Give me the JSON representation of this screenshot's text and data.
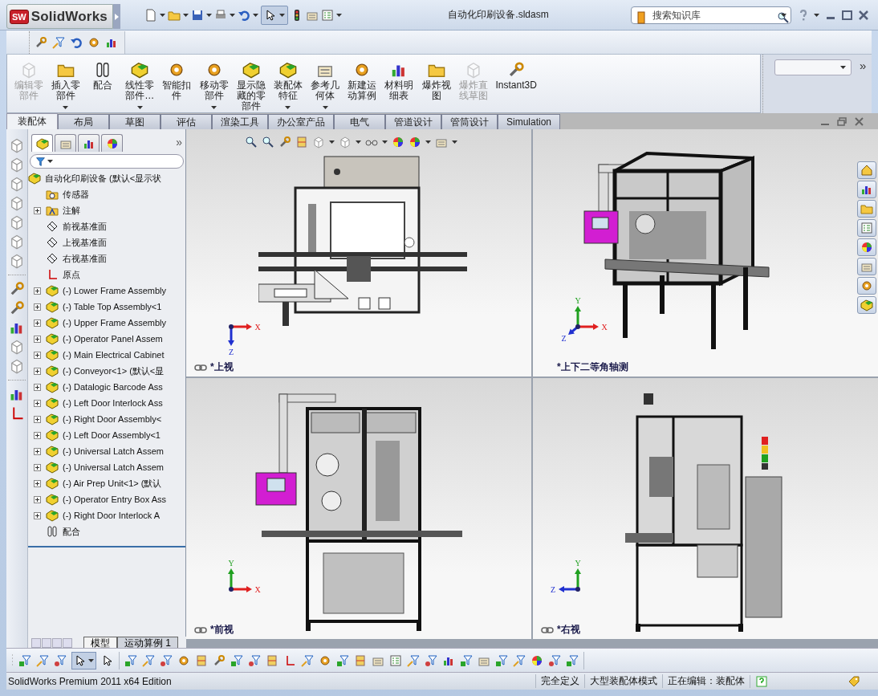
{
  "title_bar": {
    "logo_badge": "SW",
    "app_name": "SolidWorks",
    "document_title": "自动化印刷设备.sldasm",
    "search": {
      "placeholder": "搜索知识库"
    }
  },
  "command_manager": {
    "buttons": [
      {
        "label": "编辑零部件",
        "disabled": true,
        "dropdown": false
      },
      {
        "label": "插入零部件",
        "disabled": false,
        "dropdown": true
      },
      {
        "label": "配合",
        "disabled": false,
        "dropdown": false
      },
      {
        "label": "线性零部件…",
        "disabled": false,
        "dropdown": true
      },
      {
        "label": "智能扣件",
        "disabled": false,
        "dropdown": false
      },
      {
        "label": "移动零部件",
        "disabled": false,
        "dropdown": true
      },
      {
        "label": "显示隐藏的零部件",
        "disabled": false,
        "dropdown": false
      },
      {
        "label": "装配体特征",
        "disabled": false,
        "dropdown": true
      },
      {
        "label": "参考几何体",
        "disabled": false,
        "dropdown": true
      },
      {
        "label": "新建运动算例",
        "disabled": false,
        "dropdown": false
      },
      {
        "label": "材料明细表",
        "disabled": false,
        "dropdown": false
      },
      {
        "label": "爆炸视图",
        "disabled": false,
        "dropdown": false
      },
      {
        "label": "爆炸直线草图",
        "disabled": true,
        "dropdown": false
      },
      {
        "label": "Instant3D",
        "disabled": false,
        "dropdown": false
      }
    ],
    "more": "»"
  },
  "tabs": [
    {
      "label": "装配体",
      "selected": true
    },
    {
      "label": "布局",
      "selected": false
    },
    {
      "label": "草图",
      "selected": false
    },
    {
      "label": "评估",
      "selected": false
    },
    {
      "label": "渲染工具",
      "selected": false
    },
    {
      "label": "办公室产品",
      "selected": false
    },
    {
      "label": "电气",
      "selected": false
    },
    {
      "label": "管道设计",
      "selected": false
    },
    {
      "label": "管筒设计",
      "selected": false
    },
    {
      "label": "Simulation",
      "selected": false
    }
  ],
  "feature_manager": {
    "panel_tabs": [
      {
        "selected": true
      },
      {
        "selected": false
      },
      {
        "selected": false
      },
      {
        "selected": false
      }
    ],
    "more": "»",
    "tree": {
      "label": "自动化印刷设备  (默认<显示状",
      "kind": "assembly",
      "children": [
        {
          "label": "传感器",
          "kind": "sensor",
          "expandable": false
        },
        {
          "label": "注解",
          "kind": "annotation",
          "expandable": true
        },
        {
          "label": "前视基准面",
          "kind": "plane",
          "expandable": false
        },
        {
          "label": "上视基准面",
          "kind": "plane",
          "expandable": false
        },
        {
          "label": "右视基准面",
          "kind": "plane",
          "expandable": false
        },
        {
          "label": "原点",
          "kind": "origin",
          "expandable": false
        },
        {
          "label": "(-) Lower Frame Assembly",
          "kind": "assembly",
          "expandable": true
        },
        {
          "label": "(-) Table Top Assembly<1",
          "kind": "assembly",
          "expandable": true
        },
        {
          "label": "(-) Upper Frame Assembly",
          "kind": "assembly",
          "expandable": true
        },
        {
          "label": "(-) Operator Panel Assem",
          "kind": "assembly",
          "expandable": true
        },
        {
          "label": "(-) Main Electrical Cabinet",
          "kind": "assembly",
          "expandable": true
        },
        {
          "label": "(-) Conveyor<1> (默认<显",
          "kind": "assembly",
          "expandable": true
        },
        {
          "label": "(-) Datalogic Barcode Ass",
          "kind": "assembly",
          "expandable": true
        },
        {
          "label": "(-) Left Door Interlock Ass",
          "kind": "assembly",
          "expandable": true
        },
        {
          "label": "(-) Right Door Assembly<",
          "kind": "assembly",
          "expandable": true
        },
        {
          "label": "(-) Left Door Assembly<1",
          "kind": "assembly",
          "expandable": true
        },
        {
          "label": "(-) Universal Latch Assem",
          "kind": "assembly",
          "expandable": true
        },
        {
          "label": "(-) Universal Latch Assem",
          "kind": "assembly",
          "expandable": true
        },
        {
          "label": "(-) Air Prep Unit<1> (默认",
          "kind": "assembly",
          "expandable": true
        },
        {
          "label": "(-) Operator Entry Box Ass",
          "kind": "assembly",
          "expandable": true
        },
        {
          "label": "(-) Right Door Interlock A",
          "kind": "assembly",
          "expandable": true
        },
        {
          "label": "配合",
          "kind": "mates",
          "expandable": false
        }
      ]
    },
    "bottom_tabs": [
      {
        "label": "模型",
        "selected": true
      },
      {
        "label": "运动算例 1",
        "selected": false
      }
    ]
  },
  "viewports": [
    {
      "label": "*上视",
      "kind": "top",
      "linked": true,
      "axes": [
        {
          "label": "X",
          "kind": "right",
          "color": "#e02020"
        },
        {
          "label": "Z",
          "kind": "down",
          "color": "#2030d0"
        }
      ]
    },
    {
      "label": "*上下二等角轴测",
      "kind": "iso",
      "linked": false,
      "axes": [
        {
          "label": "Y",
          "kind": "up",
          "color": "#20a020"
        },
        {
          "label": "X",
          "kind": "right",
          "color": "#e02020"
        },
        {
          "label": "Z",
          "kind": "down-left",
          "color": "#2030d0"
        }
      ]
    },
    {
      "label": "*前视",
      "kind": "front",
      "linked": true,
      "axes": [
        {
          "label": "Y",
          "kind": "up",
          "color": "#20a020"
        },
        {
          "label": "X",
          "kind": "right",
          "color": "#e02020"
        }
      ]
    },
    {
      "label": "*右视",
      "kind": "right",
      "linked": true,
      "axes": [
        {
          "label": "Y",
          "kind": "up",
          "color": "#20a020"
        },
        {
          "label": "Z",
          "kind": "left",
          "color": "#2030d0"
        }
      ]
    }
  ],
  "status_bar": {
    "edition": "SolidWorks Premium 2011 x64 Edition",
    "items": [
      "完全定义",
      "大型装配体模式",
      "正在编辑：装配体"
    ]
  }
}
